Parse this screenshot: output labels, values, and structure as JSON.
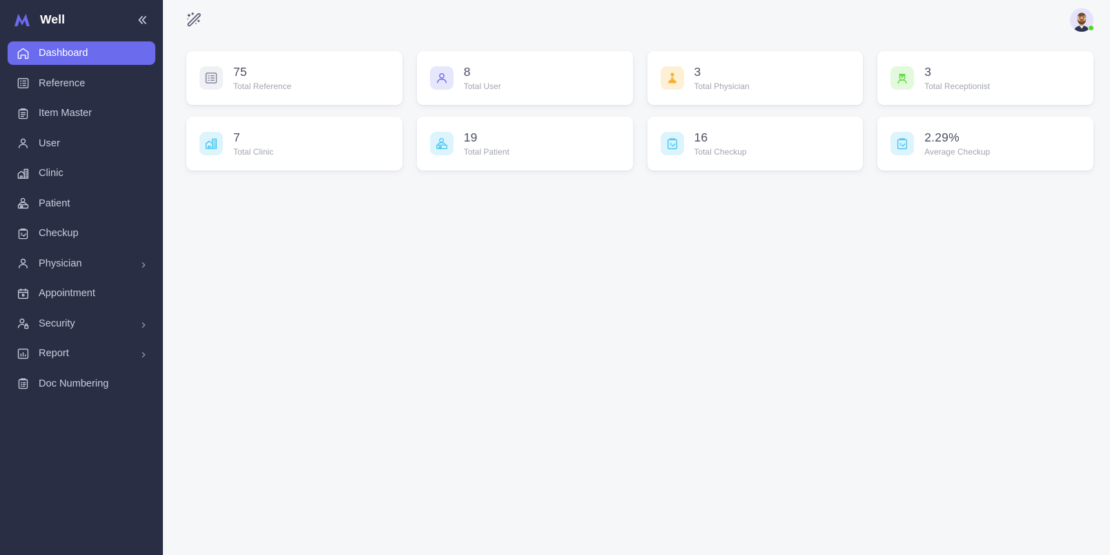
{
  "sidebar": {
    "brand": {
      "name": "Well",
      "logo_icon": "logo-m-icon",
      "logo_color": "#6b6bee"
    },
    "collapse_icon": "chevron-double-left-icon",
    "active_color": "#6b6bee",
    "background": "#2a2e45",
    "items": [
      {
        "label": "Dashboard",
        "icon": "home-icon",
        "active": true,
        "expandable": false
      },
      {
        "label": "Reference",
        "icon": "list-box-icon",
        "active": false,
        "expandable": false
      },
      {
        "label": "Item Master",
        "icon": "clipboard-icon",
        "active": false,
        "expandable": false
      },
      {
        "label": "User",
        "icon": "user-icon",
        "active": false,
        "expandable": false
      },
      {
        "label": "Clinic",
        "icon": "clinic-icon",
        "active": false,
        "expandable": false
      },
      {
        "label": "Patient",
        "icon": "patient-icon",
        "active": false,
        "expandable": false
      },
      {
        "label": "Checkup",
        "icon": "clipboard-check-icon",
        "active": false,
        "expandable": false
      },
      {
        "label": "Physician",
        "icon": "user-icon",
        "active": false,
        "expandable": true
      },
      {
        "label": "Appointment",
        "icon": "calendar-icon",
        "active": false,
        "expandable": false
      },
      {
        "label": "Security",
        "icon": "user-lock-icon",
        "active": false,
        "expandable": true
      },
      {
        "label": "Report",
        "icon": "bar-chart-icon",
        "active": false,
        "expandable": true
      },
      {
        "label": "Doc Numbering",
        "icon": "doc-number-icon",
        "active": false,
        "expandable": false
      }
    ]
  },
  "topbar": {
    "theme_toggle_icon": "magic-wand-sparkle-icon",
    "avatar_icon": "user-avatar",
    "status": "online",
    "status_color": "#52d827"
  },
  "cards": [
    {
      "value": "75",
      "label": "Total Reference",
      "icon": "list-box-icon",
      "icon_color": "#7b7f96",
      "icon_bg": "#f0f1f5"
    },
    {
      "value": "8",
      "label": "Total User",
      "icon": "user-icon",
      "icon_color": "#6b6bee",
      "icon_bg": "#e7e7fc"
    },
    {
      "value": "3",
      "label": "Total Physician",
      "icon": "physician-icon",
      "icon_color": "#f5b231",
      "icon_bg": "#fdf0d5"
    },
    {
      "value": "3",
      "label": "Total Receptionist",
      "icon": "receptionist-icon",
      "icon_color": "#5fd943",
      "icon_bg": "#e3f9dd"
    },
    {
      "value": "7",
      "label": "Total Clinic",
      "icon": "clinic-icon",
      "icon_color": "#46c6f0",
      "icon_bg": "#ddf4fd"
    },
    {
      "value": "19",
      "label": "Total Patient",
      "icon": "patient-icon",
      "icon_color": "#46c6f0",
      "icon_bg": "#ddf4fd"
    },
    {
      "value": "16",
      "label": "Total Checkup",
      "icon": "clipboard-check-icon",
      "icon_color": "#46c6f0",
      "icon_bg": "#ddf4fd"
    },
    {
      "value": "2.29%",
      "label": "Average Checkup",
      "icon": "clipboard-check-icon",
      "icon_color": "#46c6f0",
      "icon_bg": "#ddf4fd"
    }
  ]
}
